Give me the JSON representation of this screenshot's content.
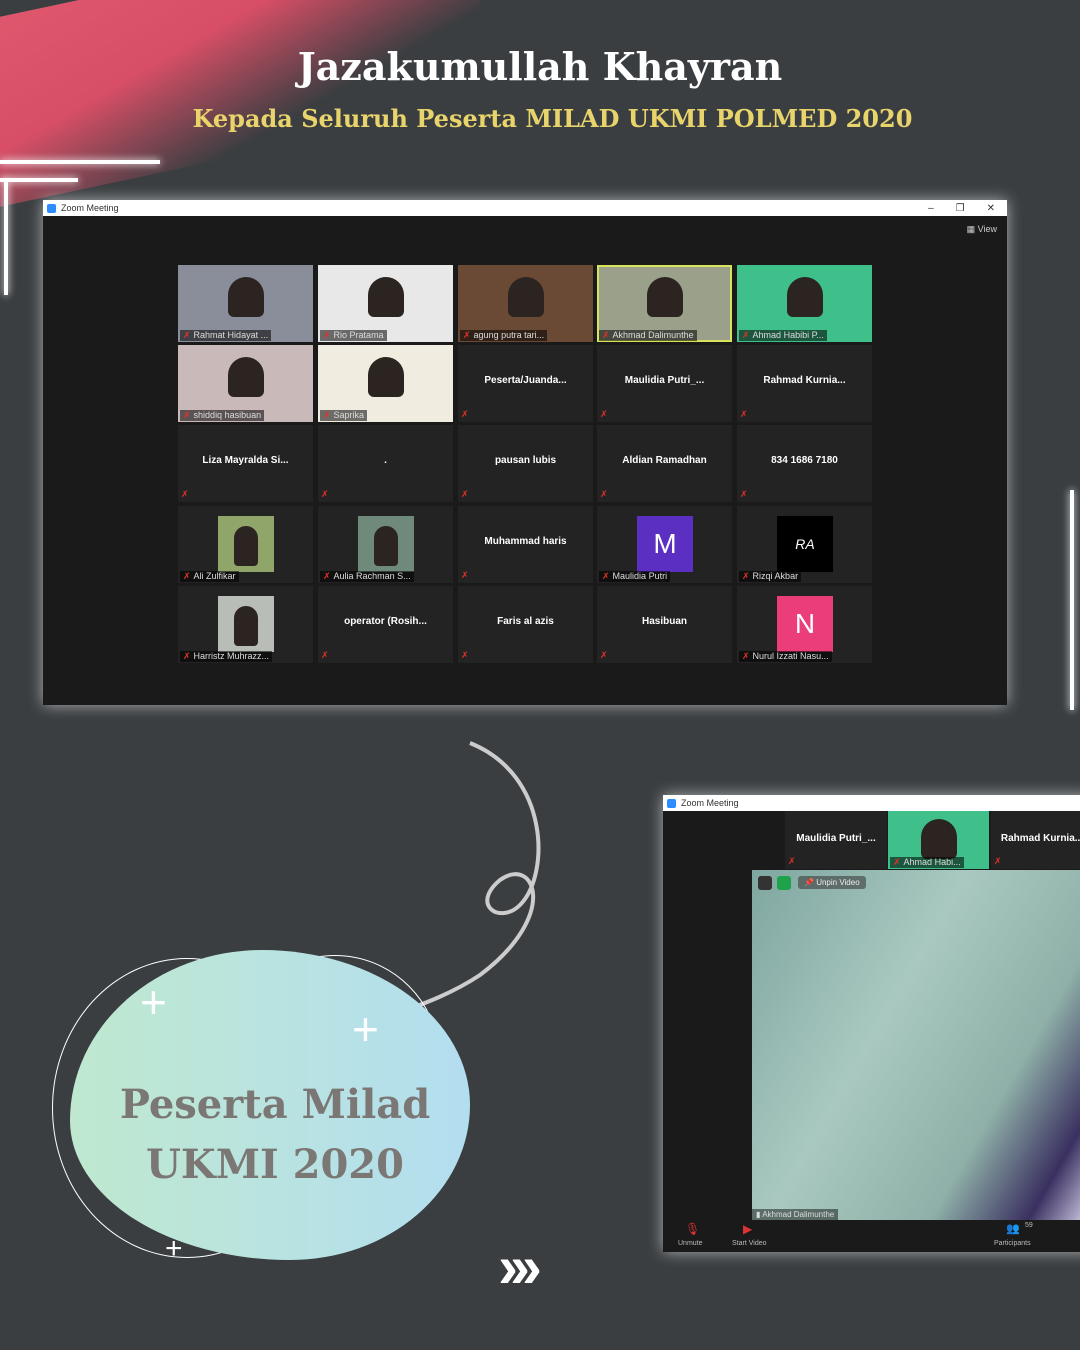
{
  "poster": {
    "title": "Jazakumullah Khayran",
    "subtitle": "Kepada Seluruh Peserta MILAD UKMI POLMED 2020",
    "badge_text": "Peserta Milad UKMI 2020",
    "arrows": "›››"
  },
  "colors": {
    "background": "#3a3e41",
    "subtitle": "#e9d46c",
    "zoom_blue": "#2d8cff",
    "mute_red": "#e0322b",
    "active_speaker": "#d7e35a"
  },
  "window_main": {
    "title": "Zoom Meeting",
    "view_label": "View",
    "tiles": [
      {
        "label": "Rahmat Hidayat ...",
        "kind": "video",
        "color": "#8a8e9a"
      },
      {
        "label": "Rio Pratama",
        "kind": "video",
        "color": "#e8e8e8"
      },
      {
        "label": "agung putra tari...",
        "kind": "video",
        "color": "#6b4a35"
      },
      {
        "label": "Akhmad Dalimunthe",
        "kind": "video",
        "color": "#9aa08a",
        "active": true
      },
      {
        "label": "Ahmad Habibi P...",
        "kind": "video",
        "color": "#3fbf8a"
      },
      {
        "label": "shiddiq hasibuan",
        "kind": "video",
        "color": "#c9b9b8"
      },
      {
        "label": "Saprika",
        "kind": "video",
        "color": "#f0ede0"
      },
      {
        "name": "Peserta/Juanda...",
        "kind": "name"
      },
      {
        "name": "Maulidia  Putri_...",
        "kind": "name"
      },
      {
        "name": "Rahmad  Kurnia...",
        "kind": "name"
      },
      {
        "name": "Liza  Mayralda  Si...",
        "kind": "name"
      },
      {
        "name": ".",
        "kind": "name"
      },
      {
        "name": "pausan lubis",
        "kind": "name"
      },
      {
        "name": "Aldian Ramadhan",
        "kind": "name"
      },
      {
        "name": "834 1686 7180",
        "kind": "name"
      },
      {
        "label": "Ali Zulfikar",
        "kind": "photo",
        "color": "#8fa56a"
      },
      {
        "label": "Aulia Rachman S...",
        "kind": "photo",
        "color": "#6f8a7a"
      },
      {
        "name": "Muhammad haris",
        "kind": "name"
      },
      {
        "label": "Maulidia Putri",
        "kind": "letter",
        "letter": "M",
        "color": "#5b2fc2"
      },
      {
        "label": "Rizqi Akbar",
        "kind": "letter",
        "letter": "RA",
        "color": "#000000"
      },
      {
        "label": "Harristz Muhrazz...",
        "kind": "photo",
        "color": "#b8bdb8"
      },
      {
        "name": "operator  (Rosih...",
        "kind": "name"
      },
      {
        "name": "Faris al azis",
        "kind": "name"
      },
      {
        "name": "Hasibuan",
        "kind": "name"
      },
      {
        "label": "Nurul Izzati Nasu...",
        "kind": "letter",
        "letter": "N",
        "color": "#ea3d7a"
      }
    ]
  },
  "window_pinned": {
    "title": "Zoom Meeting",
    "strip": [
      {
        "name": "Maulidia  Putri_..."
      },
      {
        "label": "Ahmad Habi..."
      },
      {
        "name": "Rahmad  Kurnia..."
      }
    ],
    "unpin_label": "Unpin Video",
    "speaker_label": "Akhmad Dalimunthe",
    "toolbar": {
      "unmute": "Unmute",
      "start_video": "Start Video",
      "participants": "Participants",
      "participants_count": "59"
    }
  }
}
